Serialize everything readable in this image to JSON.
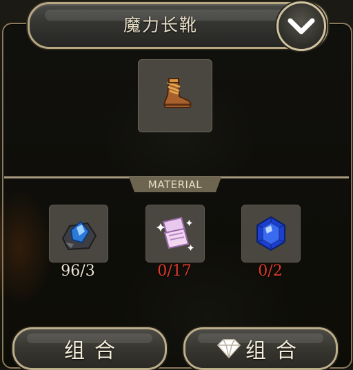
{
  "header": {
    "title": "魔力长靴",
    "toggle_icon": "chevron-down-icon"
  },
  "result_item": {
    "icon": "boots-icon"
  },
  "materials_label": "MATERIAL",
  "materials": [
    {
      "icon": "blue-crystal-ore-icon",
      "count": "96/3",
      "sufficient": true
    },
    {
      "icon": "magic-scroll-pages-icon",
      "count": "0/17",
      "sufficient": false
    },
    {
      "icon": "sapphire-gem-icon",
      "count": "0/2",
      "sufficient": false
    }
  ],
  "buttons": {
    "combine_label": "组合",
    "combine_gem_label": "组合",
    "gem_icon": "diamond-icon"
  },
  "colors": {
    "count_ok": "#ece6d6",
    "count_lack": "#e03a2a",
    "frame": "#b8a884"
  }
}
